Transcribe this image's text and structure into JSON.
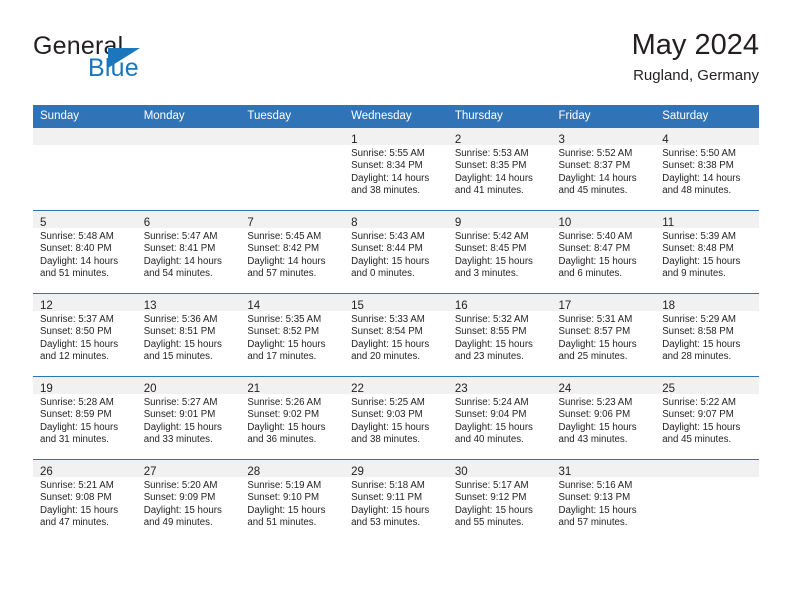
{
  "brand": {
    "name_part1": "General",
    "name_part2": "Blue",
    "triangle_color": "#1b76bc"
  },
  "header": {
    "title": "May 2024",
    "location": "Rugland, Germany"
  },
  "theme": {
    "header_row_bg": "#3074b7",
    "header_row_text": "#ffffff",
    "daynum_band_bg": "#f1f1f1",
    "row_divider": "#3074b7",
    "body_text": "#231f20"
  },
  "weekdays": [
    "Sunday",
    "Monday",
    "Tuesday",
    "Wednesday",
    "Thursday",
    "Friday",
    "Saturday"
  ],
  "weeks": [
    [
      {
        "day": "",
        "empty": true
      },
      {
        "day": "",
        "empty": true
      },
      {
        "day": "",
        "empty": true
      },
      {
        "day": "1",
        "sunrise": "Sunrise: 5:55 AM",
        "sunset": "Sunset: 8:34 PM",
        "daylight": "Daylight: 14 hours and 38 minutes."
      },
      {
        "day": "2",
        "sunrise": "Sunrise: 5:53 AM",
        "sunset": "Sunset: 8:35 PM",
        "daylight": "Daylight: 14 hours and 41 minutes."
      },
      {
        "day": "3",
        "sunrise": "Sunrise: 5:52 AM",
        "sunset": "Sunset: 8:37 PM",
        "daylight": "Daylight: 14 hours and 45 minutes."
      },
      {
        "day": "4",
        "sunrise": "Sunrise: 5:50 AM",
        "sunset": "Sunset: 8:38 PM",
        "daylight": "Daylight: 14 hours and 48 minutes."
      }
    ],
    [
      {
        "day": "5",
        "sunrise": "Sunrise: 5:48 AM",
        "sunset": "Sunset: 8:40 PM",
        "daylight": "Daylight: 14 hours and 51 minutes."
      },
      {
        "day": "6",
        "sunrise": "Sunrise: 5:47 AM",
        "sunset": "Sunset: 8:41 PM",
        "daylight": "Daylight: 14 hours and 54 minutes."
      },
      {
        "day": "7",
        "sunrise": "Sunrise: 5:45 AM",
        "sunset": "Sunset: 8:42 PM",
        "daylight": "Daylight: 14 hours and 57 minutes."
      },
      {
        "day": "8",
        "sunrise": "Sunrise: 5:43 AM",
        "sunset": "Sunset: 8:44 PM",
        "daylight": "Daylight: 15 hours and 0 minutes."
      },
      {
        "day": "9",
        "sunrise": "Sunrise: 5:42 AM",
        "sunset": "Sunset: 8:45 PM",
        "daylight": "Daylight: 15 hours and 3 minutes."
      },
      {
        "day": "10",
        "sunrise": "Sunrise: 5:40 AM",
        "sunset": "Sunset: 8:47 PM",
        "daylight": "Daylight: 15 hours and 6 minutes."
      },
      {
        "day": "11",
        "sunrise": "Sunrise: 5:39 AM",
        "sunset": "Sunset: 8:48 PM",
        "daylight": "Daylight: 15 hours and 9 minutes."
      }
    ],
    [
      {
        "day": "12",
        "sunrise": "Sunrise: 5:37 AM",
        "sunset": "Sunset: 8:50 PM",
        "daylight": "Daylight: 15 hours and 12 minutes."
      },
      {
        "day": "13",
        "sunrise": "Sunrise: 5:36 AM",
        "sunset": "Sunset: 8:51 PM",
        "daylight": "Daylight: 15 hours and 15 minutes."
      },
      {
        "day": "14",
        "sunrise": "Sunrise: 5:35 AM",
        "sunset": "Sunset: 8:52 PM",
        "daylight": "Daylight: 15 hours and 17 minutes."
      },
      {
        "day": "15",
        "sunrise": "Sunrise: 5:33 AM",
        "sunset": "Sunset: 8:54 PM",
        "daylight": "Daylight: 15 hours and 20 minutes."
      },
      {
        "day": "16",
        "sunrise": "Sunrise: 5:32 AM",
        "sunset": "Sunset: 8:55 PM",
        "daylight": "Daylight: 15 hours and 23 minutes."
      },
      {
        "day": "17",
        "sunrise": "Sunrise: 5:31 AM",
        "sunset": "Sunset: 8:57 PM",
        "daylight": "Daylight: 15 hours and 25 minutes."
      },
      {
        "day": "18",
        "sunrise": "Sunrise: 5:29 AM",
        "sunset": "Sunset: 8:58 PM",
        "daylight": "Daylight: 15 hours and 28 minutes."
      }
    ],
    [
      {
        "day": "19",
        "sunrise": "Sunrise: 5:28 AM",
        "sunset": "Sunset: 8:59 PM",
        "daylight": "Daylight: 15 hours and 31 minutes."
      },
      {
        "day": "20",
        "sunrise": "Sunrise: 5:27 AM",
        "sunset": "Sunset: 9:01 PM",
        "daylight": "Daylight: 15 hours and 33 minutes."
      },
      {
        "day": "21",
        "sunrise": "Sunrise: 5:26 AM",
        "sunset": "Sunset: 9:02 PM",
        "daylight": "Daylight: 15 hours and 36 minutes."
      },
      {
        "day": "22",
        "sunrise": "Sunrise: 5:25 AM",
        "sunset": "Sunset: 9:03 PM",
        "daylight": "Daylight: 15 hours and 38 minutes."
      },
      {
        "day": "23",
        "sunrise": "Sunrise: 5:24 AM",
        "sunset": "Sunset: 9:04 PM",
        "daylight": "Daylight: 15 hours and 40 minutes."
      },
      {
        "day": "24",
        "sunrise": "Sunrise: 5:23 AM",
        "sunset": "Sunset: 9:06 PM",
        "daylight": "Daylight: 15 hours and 43 minutes."
      },
      {
        "day": "25",
        "sunrise": "Sunrise: 5:22 AM",
        "sunset": "Sunset: 9:07 PM",
        "daylight": "Daylight: 15 hours and 45 minutes."
      }
    ],
    [
      {
        "day": "26",
        "sunrise": "Sunrise: 5:21 AM",
        "sunset": "Sunset: 9:08 PM",
        "daylight": "Daylight: 15 hours and 47 minutes."
      },
      {
        "day": "27",
        "sunrise": "Sunrise: 5:20 AM",
        "sunset": "Sunset: 9:09 PM",
        "daylight": "Daylight: 15 hours and 49 minutes."
      },
      {
        "day": "28",
        "sunrise": "Sunrise: 5:19 AM",
        "sunset": "Sunset: 9:10 PM",
        "daylight": "Daylight: 15 hours and 51 minutes."
      },
      {
        "day": "29",
        "sunrise": "Sunrise: 5:18 AM",
        "sunset": "Sunset: 9:11 PM",
        "daylight": "Daylight: 15 hours and 53 minutes."
      },
      {
        "day": "30",
        "sunrise": "Sunrise: 5:17 AM",
        "sunset": "Sunset: 9:12 PM",
        "daylight": "Daylight: 15 hours and 55 minutes."
      },
      {
        "day": "31",
        "sunrise": "Sunrise: 5:16 AM",
        "sunset": "Sunset: 9:13 PM",
        "daylight": "Daylight: 15 hours and 57 minutes."
      },
      {
        "day": "",
        "empty": true
      }
    ]
  ]
}
